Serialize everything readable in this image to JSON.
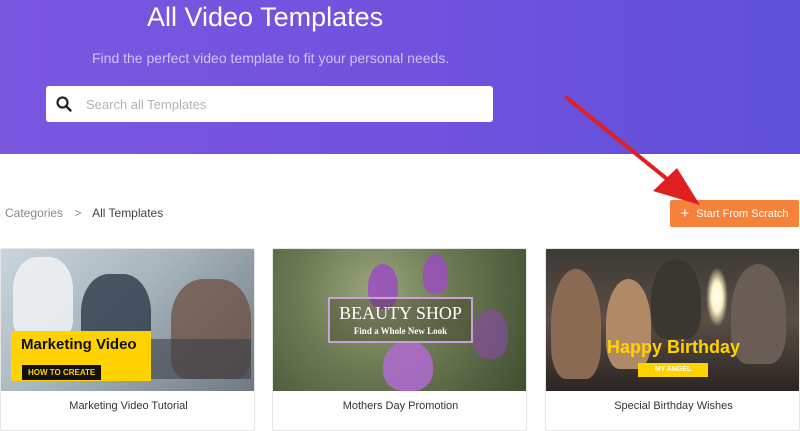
{
  "hero": {
    "title": "All Video Templates",
    "subtitle": "Find the perfect video template to fit your personal needs."
  },
  "search": {
    "placeholder": "Search all Templates",
    "value": "",
    "icon": "search-icon"
  },
  "breadcrumb": {
    "root": "Categories",
    "separator": ">",
    "current": "All Templates"
  },
  "actions": {
    "start_from_scratch": {
      "icon": "plus",
      "label": "Start From Scratch"
    }
  },
  "annotation": {
    "arrow_color": "#e02020"
  },
  "cards": [
    {
      "title": "Marketing Video Tutorial",
      "thumb_text": "Marketing Video",
      "thumb_sub": "HOW TO CREATE"
    },
    {
      "title": "Mothers Day Promotion",
      "thumb_text": "BEAUTY SHOP",
      "thumb_sub": "Find a Whole New Look"
    },
    {
      "title": "Special Birthday Wishes",
      "thumb_text": "Happy Birthday",
      "thumb_sub": "MY ANGEL"
    }
  ],
  "colors": {
    "hero_bg": "#6f52dd",
    "accent_orange": "#f5823a",
    "highlight_yellow": "#ffd200"
  }
}
